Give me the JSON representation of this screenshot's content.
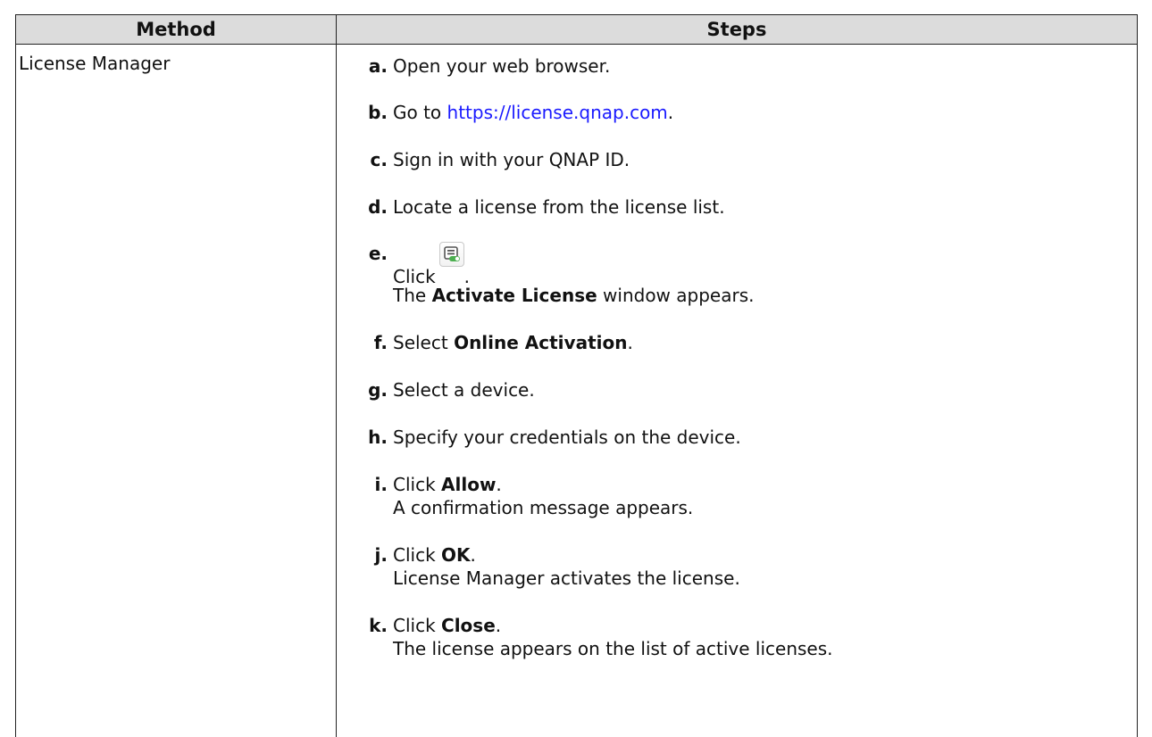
{
  "table": {
    "headers": {
      "method": "Method",
      "steps": "Steps"
    },
    "row": {
      "method": "License Manager",
      "steps": [
        {
          "letter": "a.",
          "pre": "Open your web browser."
        },
        {
          "letter": "b.",
          "pre": "Go to ",
          "link": "https://license.qnap.com",
          "post": "."
        },
        {
          "letter": "c.",
          "pre": "Sign in with your QNAP ID."
        },
        {
          "letter": "d.",
          "pre": "Locate a license from the license list."
        },
        {
          "letter": "e.",
          "pre": "Click",
          "icon": "activate-license-icon",
          "post": ".",
          "line2_pre": "The ",
          "line2_bold": "Activate License",
          "line2_post": " window appears."
        },
        {
          "letter": "f.",
          "pre": "Select ",
          "bold": "Online Activation",
          "post": "."
        },
        {
          "letter": "g.",
          "pre": "Select a device."
        },
        {
          "letter": "h.",
          "pre": "Specify your credentials on the device."
        },
        {
          "letter": "i.",
          "pre": "Click ",
          "bold": "Allow",
          "post": ".",
          "line2_pre": "A confirmation message appears."
        },
        {
          "letter": "j.",
          "pre": "Click ",
          "bold": "OK",
          "post": ".",
          "line2_pre": "License Manager activates the license."
        },
        {
          "letter": "k.",
          "pre": "Click ",
          "bold": "Close",
          "post": ".",
          "line2_pre": "The license appears on the list of active licenses."
        }
      ]
    }
  },
  "colors": {
    "header_bg": "#dcdcdc",
    "link": "#1a1aff",
    "border": "#222222",
    "icon_green": "#4caf50"
  }
}
